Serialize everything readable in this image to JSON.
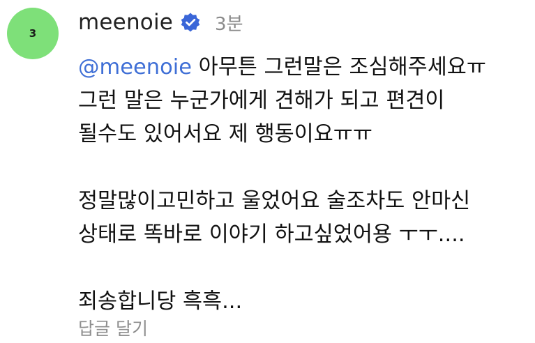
{
  "comment": {
    "avatar_text": "3",
    "username": "meenoie",
    "verified": true,
    "time": "3분",
    "mention": "@meenoie",
    "lines": [
      " 아무튼 그런말은 조심해주세요ㅠ",
      "그런 말은 누군가에게 견해가 되고 편견이",
      "될수도 있어서요 제 행동이요ㅠㅠ",
      "",
      "정말많이고민하고 울었어요 술조차도 안마신",
      "상태로 똑바로 이야기 하고싶었어용 ㅜㅜ....",
      "",
      "죄송합니당 흑흑..."
    ],
    "reply_label": "답글 달기"
  },
  "colors": {
    "avatar_bg": "#7ee079",
    "mention": "#3f6fd6",
    "verified_badge": "#3a66d8",
    "muted_text": "#8a8a8a"
  },
  "icons": {
    "verified": "verified-badge-icon"
  }
}
